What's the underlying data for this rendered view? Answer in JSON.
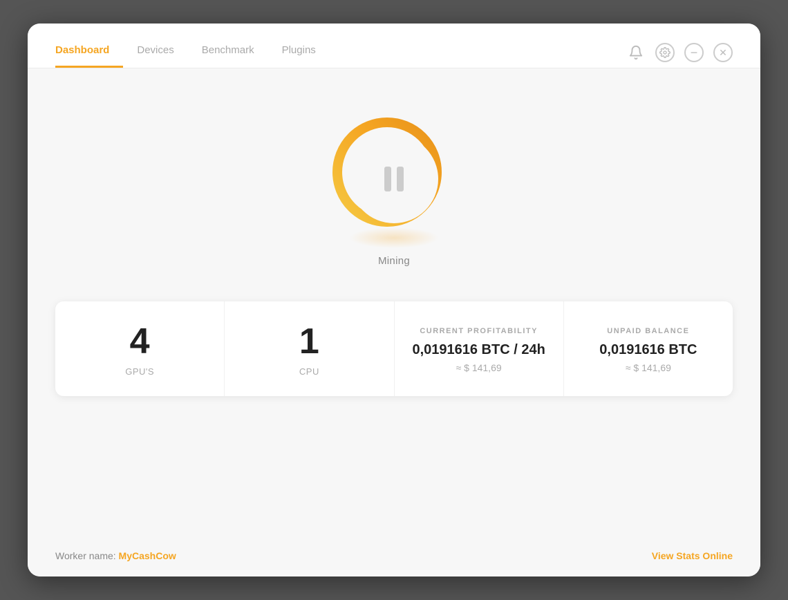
{
  "nav": {
    "tabs": [
      {
        "id": "dashboard",
        "label": "Dashboard",
        "active": true
      },
      {
        "id": "devices",
        "label": "Devices",
        "active": false
      },
      {
        "id": "benchmark",
        "label": "Benchmark",
        "active": false
      },
      {
        "id": "plugins",
        "label": "Plugins",
        "active": false
      }
    ]
  },
  "header": {
    "icons": [
      {
        "id": "bell",
        "symbol": "🔔",
        "label": "notifications"
      },
      {
        "id": "gear",
        "symbol": "⚙",
        "label": "settings"
      },
      {
        "id": "minimize",
        "symbol": "−",
        "label": "minimize"
      },
      {
        "id": "close",
        "symbol": "✕",
        "label": "close"
      }
    ]
  },
  "mining": {
    "status_label": "Mining"
  },
  "stats": [
    {
      "id": "gpus",
      "number": "4",
      "label": "GPU'S"
    },
    {
      "id": "cpu",
      "number": "1",
      "label": "CPU"
    }
  ],
  "profitability": {
    "section_label": "CURRENT PROFITABILITY",
    "btc_value": "0,0191616 BTC / 24h",
    "usd_value": "≈ $ 141,69"
  },
  "unpaid_balance": {
    "section_label": "UNPAID BALANCE",
    "btc_value": "0,0191616 BTC",
    "usd_value": "≈ $ 141,69"
  },
  "footer": {
    "worker_prefix": "Worker name: ",
    "worker_name": "MyCashCow",
    "view_stats_label": "View Stats Online"
  },
  "colors": {
    "accent": "#f5a623",
    "text_dark": "#222",
    "text_muted": "#aaa",
    "text_light": "#888"
  }
}
